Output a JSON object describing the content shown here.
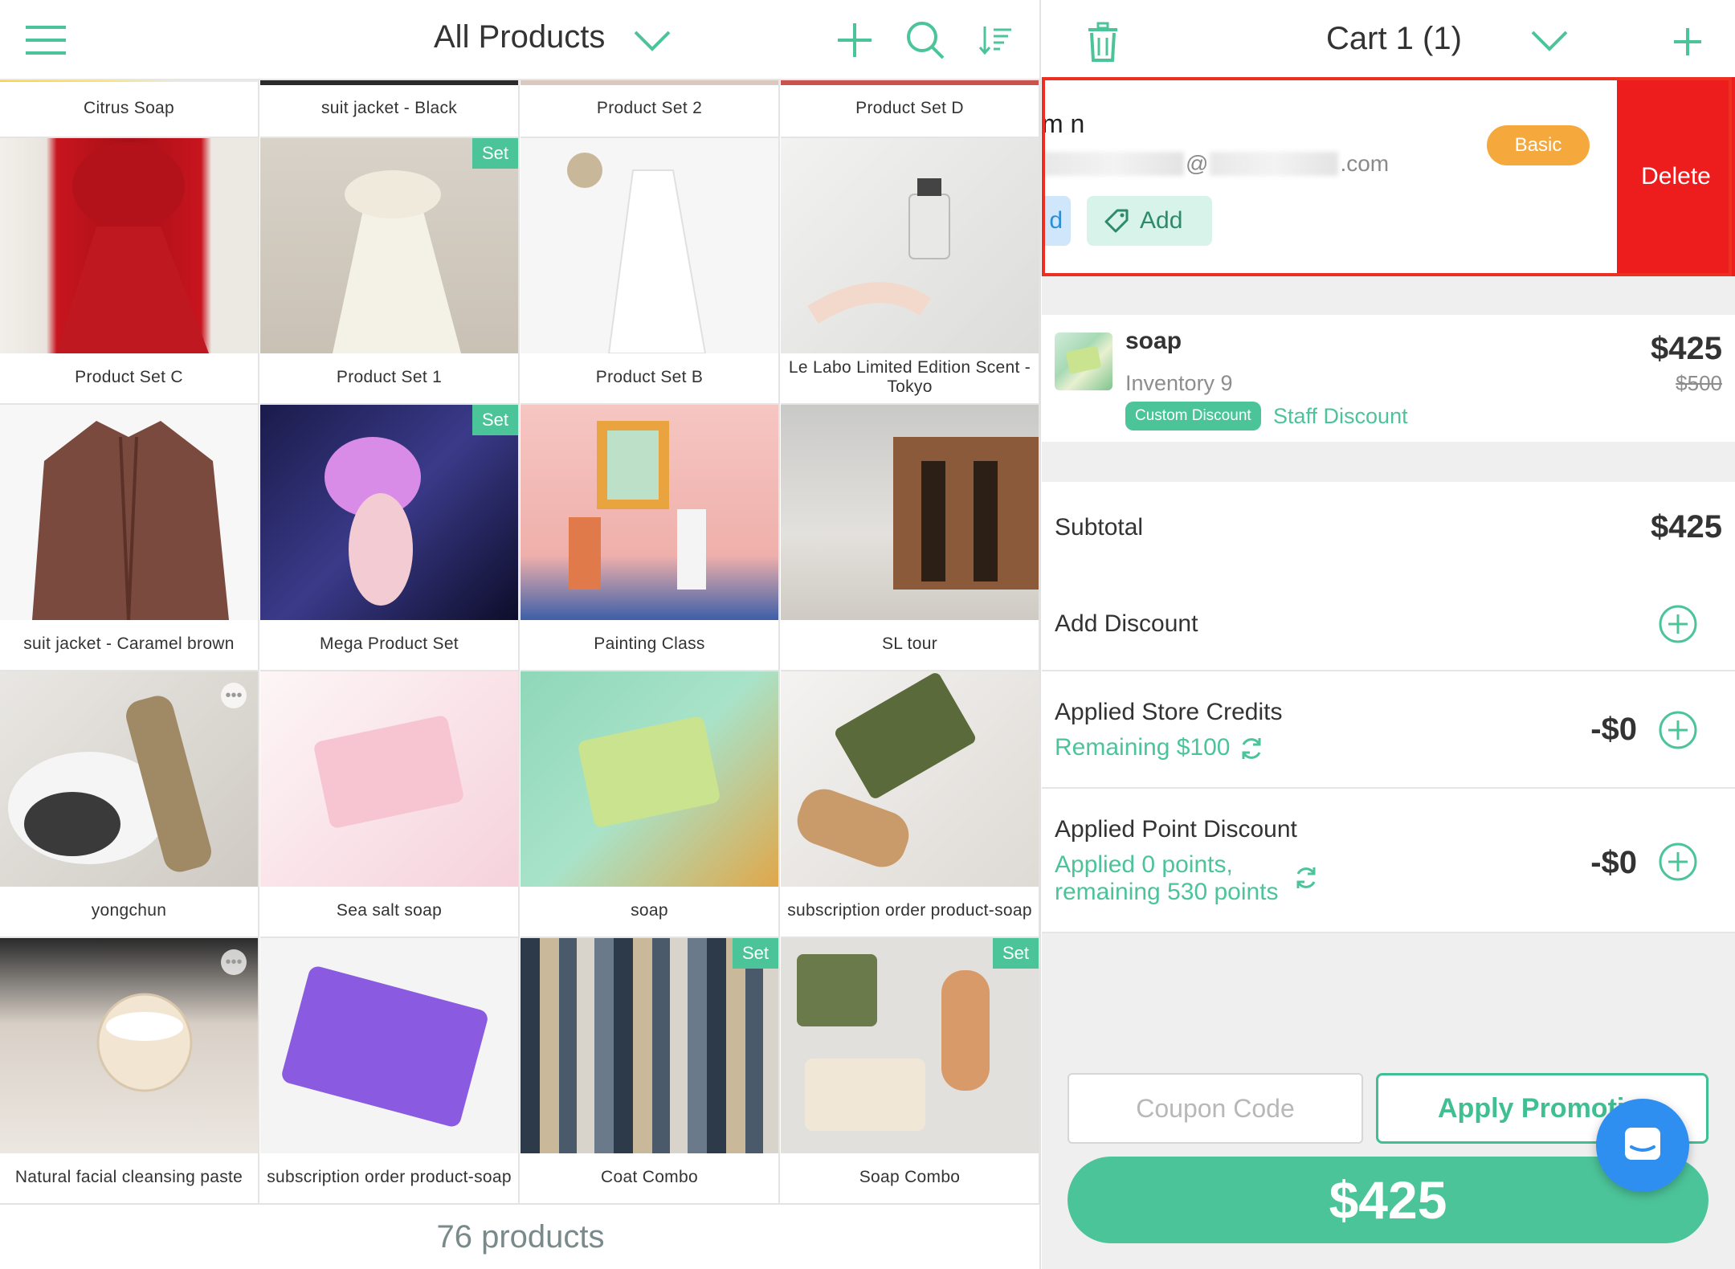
{
  "products_header": {
    "title": "All Products",
    "icons": {
      "menu": "hamburger-menu-icon",
      "dropdown": "chevron-down-icon",
      "add": "plus-icon",
      "search": "search-icon",
      "sort": "sort-icon"
    }
  },
  "products": [
    {
      "name": "Citrus Soap"
    },
    {
      "name": "suit jacket - Black"
    },
    {
      "name": "Product Set 2"
    },
    {
      "name": "Product Set D"
    },
    {
      "name": "Product Set C"
    },
    {
      "name": "Product Set 1",
      "badge": "Set"
    },
    {
      "name": "Product Set B"
    },
    {
      "name": "Le Labo Limited Edition Scent - Tokyo"
    },
    {
      "name": "suit jacket - Caramel brown"
    },
    {
      "name": "Mega Product Set",
      "badge": "Set"
    },
    {
      "name": "Painting Class"
    },
    {
      "name": "SL tour"
    },
    {
      "name": "yongchun",
      "more": "•••"
    },
    {
      "name": "Sea salt soap"
    },
    {
      "name": "soap"
    },
    {
      "name": "subscription order product-soap"
    },
    {
      "name": "Natural facial cleansing paste",
      "more": "•••"
    },
    {
      "name": "subscription order product-soap"
    },
    {
      "name": "Coat Combo",
      "badge": "Set"
    },
    {
      "name": "Soap Combo",
      "badge": "Set"
    }
  ],
  "products_footer": {
    "count_label": "76 products"
  },
  "cart_header": {
    "title": "Cart 1 (1)",
    "icons": {
      "trash": "trash-icon",
      "dropdown": "chevron-down-icon",
      "add": "plus-icon"
    }
  },
  "customer": {
    "name": "m n",
    "email_at": "@",
    "email_tail": ".com",
    "tag_partial": "d",
    "add_tag_label": "Add",
    "membership": "Basic",
    "delete_label": "Delete"
  },
  "line_item": {
    "name": "soap",
    "inventory": "Inventory 9",
    "badge": "Custom Discount",
    "discount": "Staff Discount",
    "price": "$425",
    "original_price": "$500"
  },
  "summary": {
    "subtotal_label": "Subtotal",
    "subtotal_value": "$425",
    "add_discount_label": "Add Discount",
    "store_credits_label": "Applied Store Credits",
    "store_credits_remaining": "Remaining $100",
    "store_credits_value": "-$0",
    "points_label": "Applied Point Discount",
    "points_line1": "Applied 0 points,",
    "points_line2": "remaining 530 points",
    "points_value": "-$0"
  },
  "checkout": {
    "coupon_placeholder": "Coupon Code",
    "apply_promo_label": "Apply Promotion",
    "total": "$425"
  },
  "colors": {
    "accent": "#4cc49a",
    "delete": "#ee1d1d",
    "badge_basic": "#f5a93c",
    "chat": "#2f8ff0"
  }
}
